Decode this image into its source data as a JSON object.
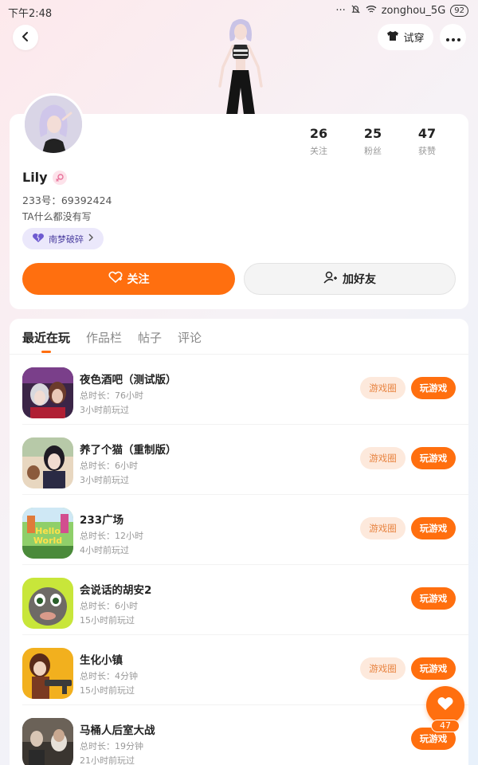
{
  "status_bar": {
    "time": "下午2:48",
    "dots": "···",
    "carrier": "zonghou_5G",
    "battery": "92"
  },
  "header": {
    "tryon_label": "试穿"
  },
  "profile": {
    "username": "Lily",
    "uid_line": "233号：69392424",
    "bio": "TA什么都没有写",
    "tag_label": "南梦破碎",
    "stats": [
      {
        "value": "26",
        "label": "关注"
      },
      {
        "value": "25",
        "label": "粉丝"
      },
      {
        "value": "47",
        "label": "获赞"
      }
    ],
    "follow_label": "关注",
    "add_friend_label": "加好友"
  },
  "tabs": [
    "最近在玩",
    "作品栏",
    "帖子",
    "评论"
  ],
  "games": [
    {
      "title": "夜色酒吧（测试版）",
      "duration": "总时长：76小时",
      "last_played": "3小时前玩过",
      "circle_label": "游戏圈",
      "play_label": "玩游戏"
    },
    {
      "title": "养了个猫（重制版）",
      "duration": "总时长：6小时",
      "last_played": "3小时前玩过",
      "circle_label": "游戏圈",
      "play_label": "玩游戏"
    },
    {
      "title": "233广场",
      "duration": "总时长：12小时",
      "last_played": "4小时前玩过",
      "circle_label": "游戏圈",
      "play_label": "玩游戏",
      "icon_text": "Hello World"
    },
    {
      "title": "会说话的胡安2",
      "duration": "总时长：6小时",
      "last_played": "15小时前玩过",
      "circle_label": null,
      "play_label": "玩游戏"
    },
    {
      "title": "生化小镇",
      "duration": "总时长：4分钟",
      "last_played": "15小时前玩过",
      "circle_label": "游戏圈",
      "play_label": "玩游戏"
    },
    {
      "title": "马桶人后室大战",
      "duration": "总时长：19分钟",
      "last_played": "21小时前玩过",
      "circle_label": null,
      "play_label": "玩游戏"
    }
  ],
  "like_fab": {
    "count": "47"
  },
  "icons": {
    "back": "chevron-left-icon",
    "tryon": "shirt-icon",
    "more": "more-dots-icon",
    "gender": "female-icon",
    "tag": "heart-icon",
    "follow": "heart-plus-icon",
    "add_friend": "user-plus-icon",
    "like": "heart-icon"
  },
  "colors": {
    "accent": "#ff6f0f",
    "circle_bg": "#fde9dc",
    "tag_bg": "#ebe8fb"
  }
}
